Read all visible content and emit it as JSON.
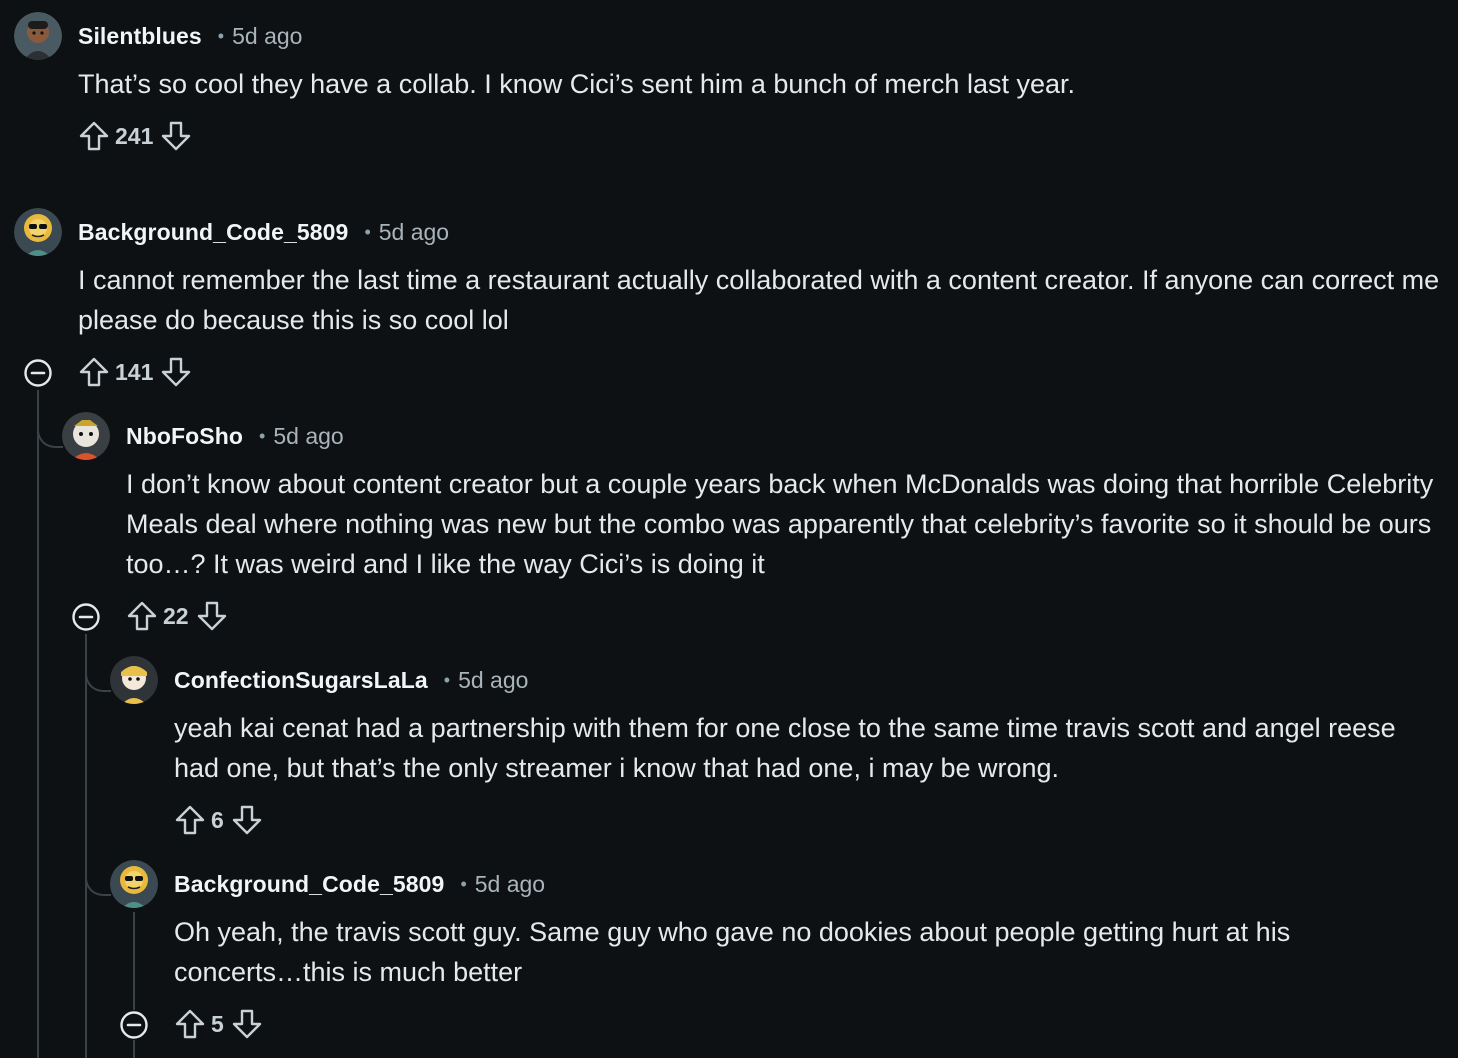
{
  "comments": [
    {
      "username": "Silentblues",
      "time": "5d ago",
      "body": "That’s so cool they have a collab. I know Cici’s sent him a bunch of merch last year.",
      "score": "241"
    },
    {
      "username": "Background_Code_5809",
      "time": "5d ago",
      "body": "I cannot remember the last time a restaurant actually collaborated with a content creator. If anyone can correct me please do because this is so cool lol",
      "score": "141"
    },
    {
      "username": "NboFoSho",
      "time": "5d ago",
      "body": "I don’t know about content creator but a couple years back when McDonalds was doing that horrible Celebrity Meals deal where nothing was new but the combo was apparently that celebrity’s favorite so it should be ours too…? It was weird and I like the way Cici’s is doing it",
      "score": "22"
    },
    {
      "username": "ConfectionSugarsLaLa",
      "time": "5d ago",
      "body": "yeah kai cenat had a partnership with them for one close to the same time travis scott and angel reese had one, but that’s the only streamer i know that had one, i may be wrong.",
      "score": "6"
    },
    {
      "username": "Background_Code_5809",
      "time": "5d ago",
      "body": "Oh yeah, the travis scott guy. Same guy who gave no dookies about people getting hurt at his concerts…this is much better",
      "score": "5"
    }
  ],
  "separator": "•",
  "icons": {
    "upvote": "arrow-up-outline-icon",
    "downvote": "arrow-down-outline-icon",
    "collapse": "minus-circle-icon"
  }
}
